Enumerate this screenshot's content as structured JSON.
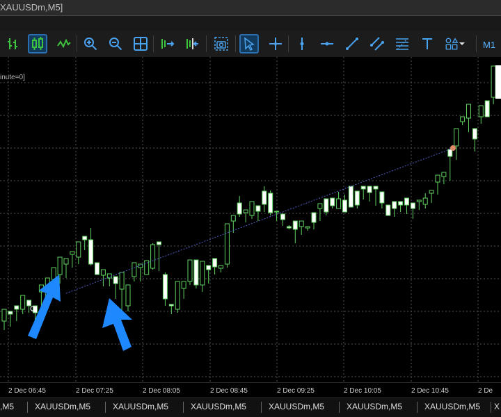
{
  "window": {
    "title": "XAUUSDm,M5]"
  },
  "indicator_label": "inute=0]",
  "timeframe": "M1",
  "toolbar": {
    "items": [
      {
        "name": "bar-chart-icon",
        "active": false
      },
      {
        "name": "candlestick-chart-icon",
        "active": true
      },
      {
        "name": "line-chart-icon",
        "active": false
      },
      {
        "name": "zoom-in-icon",
        "active": false
      },
      {
        "name": "zoom-out-icon",
        "active": false
      },
      {
        "name": "grid-icon",
        "active": false
      },
      {
        "name": "auto-scroll-icon",
        "active": false
      },
      {
        "name": "chart-shift-icon",
        "active": false
      },
      {
        "name": "screenshot-icon",
        "active": false
      },
      {
        "name": "cursor-icon",
        "active": true
      },
      {
        "name": "crosshair-icon",
        "active": false
      },
      {
        "name": "vertical-line-icon",
        "active": false
      },
      {
        "name": "horizontal-line-icon",
        "active": false
      },
      {
        "name": "trendline-icon",
        "active": false
      },
      {
        "name": "channel-icon",
        "active": false
      },
      {
        "name": "fibonacci-icon",
        "active": false
      },
      {
        "name": "text-icon",
        "active": false
      },
      {
        "name": "shapes-icon",
        "active": false
      }
    ]
  },
  "colors": {
    "bull": "#000000",
    "bullBorder": "#5fd35f",
    "bear": "#ffffff",
    "wick": "#5fd35f",
    "grid": "#555555",
    "trend": "#5560c8",
    "arrow": "#1e88ff"
  },
  "xaxis": {
    "labels": [
      "2 Dec 06:45",
      "2 Dec 07:25",
      "2 Dec 08:05",
      "2 Dec 08:45",
      "2 Dec 09:25",
      "2 Dec 10:05",
      "2 Dec 10:45",
      "2 De"
    ]
  },
  "tabs": [
    "XAUUSDm,M5",
    "XAUUSDm,M5",
    "XAUUSDm,M5",
    "XAUUSDm,M5",
    "XAUUSDm,M5",
    "XAUUSDm,M5",
    "XAUUSDm,M5"
  ],
  "tabs_partial": [
    ",M5",
    "X"
  ],
  "chart_data": {
    "type": "candlestick",
    "symbol": "XAUUSDm",
    "timeframe": "M5",
    "ohlc": [
      [
        462,
        445,
        475,
        470
      ],
      [
        448,
        452,
        470,
        465
      ],
      [
        440,
        445,
        462,
        460
      ],
      [
        445,
        425,
        452,
        430
      ],
      [
        432,
        440,
        450,
        445
      ],
      [
        440,
        450,
        462,
        455
      ],
      [
        420,
        410,
        442,
        440
      ],
      [
        428,
        400,
        432,
        405
      ],
      [
        402,
        385,
        418,
        415
      ],
      [
        395,
        370,
        408,
        400
      ],
      [
        380,
        372,
        400,
        390
      ],
      [
        366,
        362,
        385,
        382
      ],
      [
        370,
        348,
        380,
        352
      ],
      [
        340,
        345,
        360,
        355
      ],
      [
        345,
        380,
        328,
        382
      ],
      [
        378,
        395,
        386,
        394
      ],
      [
        396,
        388,
        412,
        410
      ],
      [
        400,
        394,
        412,
        400
      ],
      [
        398,
        408,
        430,
        420
      ],
      [
        416,
        392,
        452,
        445
      ],
      [
        440,
        410,
        448,
        415
      ],
      [
        398,
        378,
        405,
        400
      ],
      [
        385,
        380,
        405,
        390
      ],
      [
        395,
        375,
        385,
        380
      ],
      [
        386,
        352,
        388,
        350
      ],
      [
        348,
        352,
        390,
        385
      ],
      [
        395,
        430,
        392,
        440
      ],
      [
        438,
        440,
        452,
        448
      ],
      [
        445,
        405,
        450,
        410
      ],
      [
        415,
        405,
        430,
        420
      ],
      [
        405,
        374,
        410,
        378
      ],
      [
        374,
        410,
        380,
        415
      ],
      [
        410,
        376,
        420,
        380
      ],
      [
        382,
        388,
        408,
        405
      ],
      [
        372,
        384,
        390,
        395
      ],
      [
        386,
        382,
        390,
        392
      ],
      [
        380,
        322,
        385,
        330
      ],
      [
        318,
        310,
        335,
        325
      ],
      [
        292,
        308,
        282,
        312
      ],
      [
        306,
        302,
        320,
        318
      ],
      [
        310,
        290,
        305,
        315
      ],
      [
        296,
        304,
        318,
        312
      ],
      [
        275,
        294,
        268,
        305
      ],
      [
        278,
        306,
        274,
        310
      ],
      [
        304,
        305,
        316,
        318
      ],
      [
        308,
        316,
        322,
        325
      ],
      [
        326,
        328,
        324,
        330
      ],
      [
        318,
        330,
        350,
        345
      ],
      [
        326,
        318,
        338,
        332
      ],
      [
        328,
        326,
        332,
        330
      ],
      [
        306,
        320,
        330,
        325
      ],
      [
        300,
        293,
        312,
        318
      ],
      [
        286,
        305,
        292,
        310
      ],
      [
        285,
        296,
        298,
        300
      ],
      [
        300,
        286,
        280,
        276
      ],
      [
        288,
        305,
        280,
        300
      ],
      [
        268,
        298,
        292,
        296
      ],
      [
        275,
        295,
        290,
        300
      ],
      [
        268,
        272,
        282,
        287
      ],
      [
        268,
        277,
        285,
        290
      ],
      [
        268,
        272,
        290,
        296
      ],
      [
        276,
        292,
        294,
        300
      ],
      [
        295,
        310,
        300,
        305
      ],
      [
        290,
        300,
        305,
        312
      ],
      [
        290,
        295,
        300,
        305
      ],
      [
        285,
        295,
        300,
        308
      ],
      [
        292,
        300,
        310,
        315
      ],
      [
        290,
        288,
        300,
        302
      ],
      [
        294,
        285,
        278,
        300
      ],
      [
        278,
        274,
        290,
        292
      ],
      [
        262,
        252,
        275,
        280
      ],
      [
        254,
        248,
        260,
        265
      ],
      [
        215,
        225,
        255,
        260
      ],
      [
        210,
        185,
        220,
        230
      ],
      [
        175,
        168,
        180,
        180
      ],
      [
        170,
        150,
        185,
        190
      ],
      [
        185,
        200,
        210,
        218
      ],
      [
        168,
        152,
        175,
        178
      ],
      [
        145,
        168,
        150,
        155
      ],
      [
        140,
        95,
        148,
        150
      ]
    ]
  }
}
